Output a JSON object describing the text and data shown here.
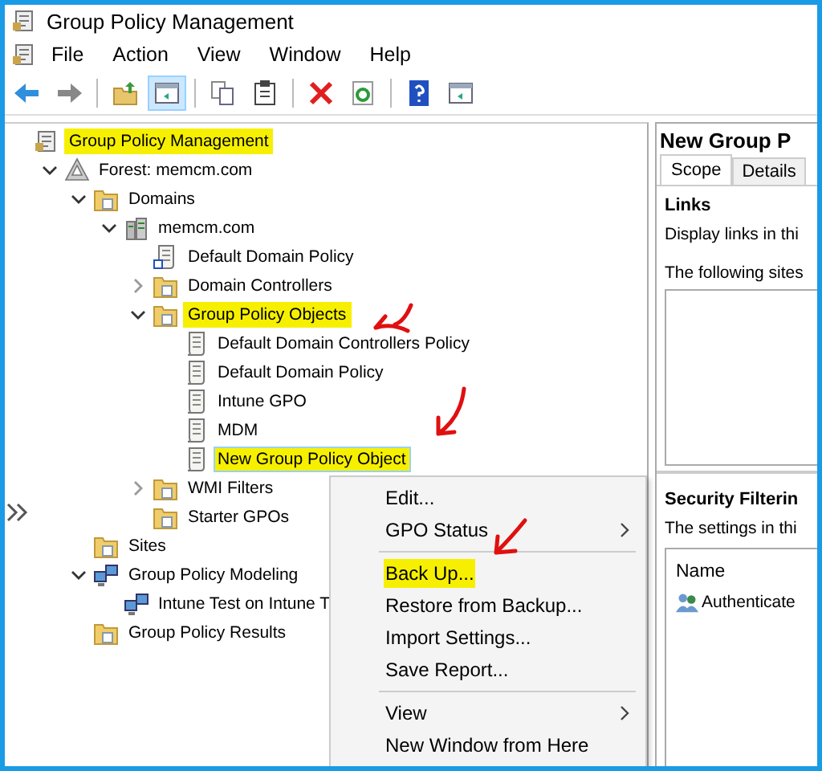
{
  "window": {
    "title": "Group Policy Management"
  },
  "menu_bar": [
    "File",
    "Action",
    "View",
    "Window",
    "Help"
  ],
  "toolbar": [
    [
      {
        "kind": "back",
        "pressed": false
      },
      {
        "kind": "forward",
        "pressed": false
      }
    ],
    [
      {
        "kind": "up",
        "pressed": false
      },
      {
        "kind": "tree",
        "pressed": true
      }
    ],
    [
      {
        "kind": "copy",
        "pressed": false
      },
      {
        "kind": "paste",
        "pressed": false
      }
    ],
    [
      {
        "kind": "delete",
        "pressed": false
      },
      {
        "kind": "refresh",
        "pressed": false
      }
    ],
    [
      {
        "kind": "help",
        "pressed": false
      },
      {
        "kind": "console",
        "pressed": false
      }
    ]
  ],
  "tree": [
    {
      "label": "Group Policy Management",
      "kind": "console",
      "selected": false,
      "highlighted": true,
      "children": [
        {
          "label": "Forest: memcm.com",
          "kind": "forest",
          "selected": false,
          "highlighted": false,
          "expanded": true,
          "children": [
            {
              "label": "Domains",
              "kind": "folder",
              "selected": false,
              "highlighted": false,
              "expanded": true,
              "children": [
                {
                  "label": "memcm.com",
                  "kind": "server",
                  "selected": false,
                  "highlighted": false,
                  "expanded": true,
                  "children": [
                    {
                      "label": "Default Domain Policy",
                      "kind": "link",
                      "selected": false,
                      "highlighted": false
                    },
                    {
                      "label": "Domain Controllers",
                      "kind": "folder",
                      "selected": false,
                      "highlighted": false,
                      "expanded": false
                    },
                    {
                      "label": "Group Policy Objects",
                      "kind": "folder",
                      "selected": false,
                      "highlighted": true,
                      "expanded": true,
                      "children": [
                        {
                          "label": "Default Domain Controllers Policy",
                          "kind": "scroll",
                          "selected": false,
                          "highlighted": false
                        },
                        {
                          "label": "Default Domain Policy",
                          "kind": "scroll",
                          "selected": false,
                          "highlighted": false
                        },
                        {
                          "label": "Intune GPO",
                          "kind": "scroll",
                          "selected": false,
                          "highlighted": false
                        },
                        {
                          "label": "MDM",
                          "kind": "scroll",
                          "selected": false,
                          "highlighted": false
                        },
                        {
                          "label": "New Group Policy Object",
                          "kind": "scroll",
                          "selected": true,
                          "highlighted": true
                        }
                      ]
                    },
                    {
                      "label": "WMI Filters",
                      "kind": "folder",
                      "selected": false,
                      "highlighted": false,
                      "expanded": false
                    },
                    {
                      "label": "Starter GPOs",
                      "kind": "folder",
                      "selected": false,
                      "highlighted": false
                    }
                  ]
                }
              ]
            },
            {
              "label": "Sites",
              "kind": "folder",
              "selected": false,
              "highlighted": false
            },
            {
              "label": "Group Policy Modeling",
              "kind": "computer",
              "selected": false,
              "highlighted": false,
              "expanded": true,
              "children": [
                {
                  "label": "Intune Test on Intune T",
                  "kind": "computer",
                  "selected": false,
                  "highlighted": false
                }
              ]
            },
            {
              "label": "Group Policy Results",
              "kind": "folder",
              "selected": false,
              "highlighted": false
            }
          ]
        }
      ]
    }
  ],
  "details": {
    "title": "New Group P",
    "tabs": [
      {
        "label": "Scope",
        "selected": true
      },
      {
        "label": "Details",
        "selected": false
      }
    ],
    "links_heading": "Links",
    "links_text": "Display links in thi",
    "links_caption": "The following sites",
    "security_heading": "Security Filterin",
    "security_text": "The settings in thi",
    "security_table": {
      "columns": [
        "Name"
      ],
      "rows": [
        "Authenticate"
      ]
    }
  },
  "context_menu": [
    {
      "kind": "item",
      "label": "Edit...",
      "highlighted": false
    },
    {
      "kind": "submenu",
      "label": "GPO Status",
      "highlighted": false
    },
    {
      "kind": "separator"
    },
    {
      "kind": "item",
      "label": "Back Up...",
      "highlighted": true
    },
    {
      "kind": "item",
      "label": "Restore from Backup...",
      "highlighted": false
    },
    {
      "kind": "item",
      "label": "Import Settings...",
      "highlighted": false
    },
    {
      "kind": "item",
      "label": "Save Report...",
      "highlighted": false
    },
    {
      "kind": "separator"
    },
    {
      "kind": "submenu",
      "label": "View",
      "highlighted": false
    },
    {
      "kind": "item",
      "label": "New Window from Here",
      "highlighted": false
    }
  ]
}
